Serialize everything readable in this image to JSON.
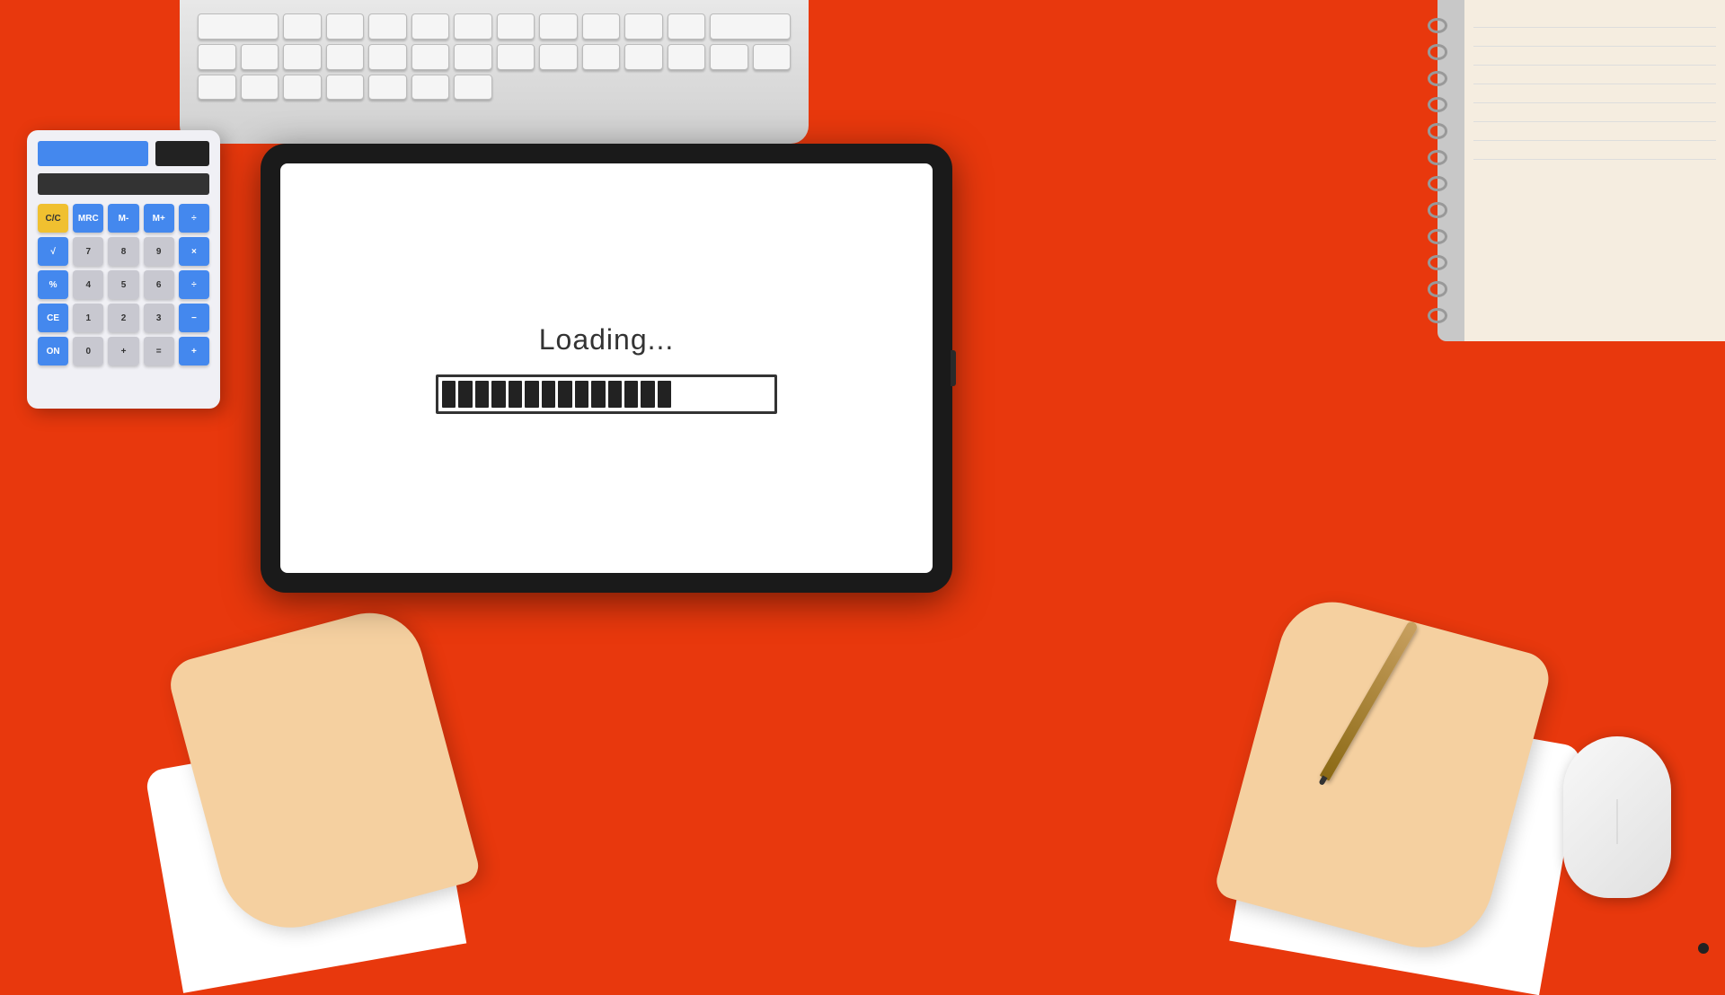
{
  "background": {
    "color": "#e8380d"
  },
  "tablet": {
    "loading_text": "Loading...",
    "progress_filled_segments": 14,
    "progress_total_segments": 20
  },
  "calculator": {
    "buttons": [
      {
        "label": "C/C",
        "type": "yellow"
      },
      {
        "label": "MRC",
        "type": "blue"
      },
      {
        "label": "M-",
        "type": "blue"
      },
      {
        "label": "M+",
        "type": "blue"
      },
      {
        "label": "÷",
        "type": "blue"
      },
      {
        "label": "√",
        "type": "blue"
      },
      {
        "label": "7",
        "type": "gray"
      },
      {
        "label": "8",
        "type": "gray"
      },
      {
        "label": "9",
        "type": "gray"
      },
      {
        "label": "×",
        "type": "blue"
      },
      {
        "label": "%",
        "type": "blue"
      },
      {
        "label": "4",
        "type": "gray"
      },
      {
        "label": "5",
        "type": "gray"
      },
      {
        "label": "6",
        "type": "gray"
      },
      {
        "label": "÷",
        "type": "blue"
      },
      {
        "label": "CE",
        "type": "blue"
      },
      {
        "label": "1",
        "type": "gray"
      },
      {
        "label": "2",
        "type": "gray"
      },
      {
        "label": "3",
        "type": "gray"
      },
      {
        "label": "−",
        "type": "blue"
      },
      {
        "label": "ON",
        "type": "blue"
      },
      {
        "label": "0",
        "type": "gray"
      },
      {
        "label": "+",
        "type": "gray"
      },
      {
        "label": "=",
        "type": "gray"
      },
      {
        "label": "+",
        "type": "blue"
      }
    ]
  },
  "dot_indicator": {
    "visible": true
  }
}
